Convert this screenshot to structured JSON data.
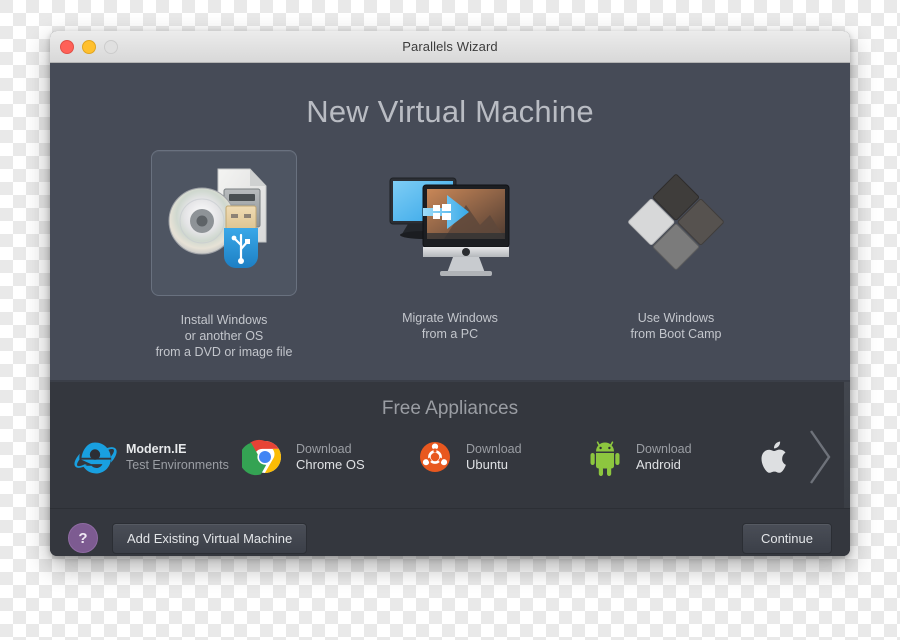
{
  "window": {
    "title": "Parallels Wizard",
    "traffic_lights": [
      {
        "name": "close",
        "color": "#ff6158"
      },
      {
        "name": "minimize",
        "color": "#ffc02e"
      },
      {
        "name": "zoom",
        "color": "#e0e0e0"
      }
    ]
  },
  "main": {
    "heading": "New Virtual Machine",
    "options": [
      {
        "id": "install-windows",
        "icon": "dvd-usb-image-icon",
        "label": "Install Windows\nor another OS\nfrom a DVD or image file",
        "selected": true
      },
      {
        "id": "migrate-windows",
        "icon": "pc-to-mac-migration-icon",
        "label": "Migrate Windows\nfrom a PC",
        "selected": false
      },
      {
        "id": "boot-camp",
        "icon": "boot-camp-diamond-icon",
        "label": "Use Windows\nfrom Boot Camp",
        "selected": false
      }
    ]
  },
  "appliances": {
    "title": "Free Appliances",
    "items": [
      {
        "id": "modern-ie",
        "icon": "internet-explorer-icon",
        "line1": "Modern.IE",
        "line2": "Test Environments"
      },
      {
        "id": "chrome-os",
        "icon": "chrome-icon",
        "line1": "Download",
        "line2": "Chrome OS"
      },
      {
        "id": "ubuntu",
        "icon": "ubuntu-icon",
        "line1": "Download",
        "line2": "Ubuntu"
      },
      {
        "id": "android",
        "icon": "android-icon",
        "line1": "Download",
        "line2": "Android"
      },
      {
        "id": "apple",
        "icon": "apple-icon",
        "line1": "",
        "line2": ""
      }
    ],
    "next_arrow": "chevron-right-icon"
  },
  "toolbar": {
    "help_label": "?",
    "add_existing_label": "Add Existing Virtual Machine",
    "continue_label": "Continue"
  },
  "colors": {
    "window_top_bg": "#464b57",
    "appliances_bg": "#34373e",
    "accent_help": "#7d5b91",
    "heading_text": "#b9bcc3"
  }
}
